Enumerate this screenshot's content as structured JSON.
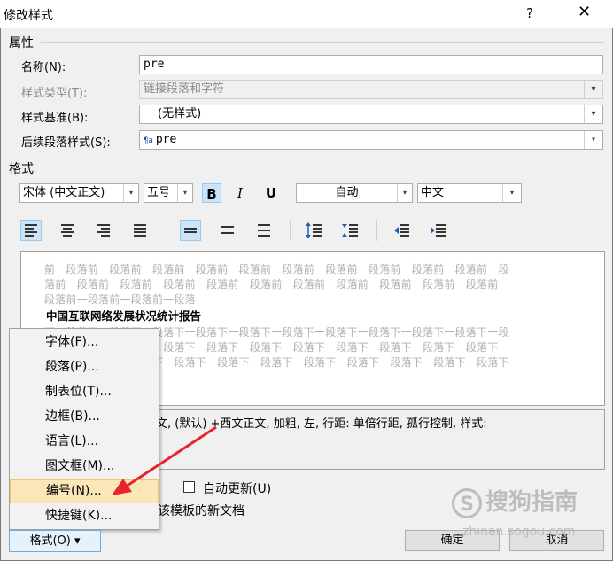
{
  "window": {
    "title": "修改样式",
    "help": "?",
    "close": "✕"
  },
  "properties": {
    "section": "属性",
    "name_label": "名称(N):",
    "name_value": "pre",
    "type_label": "样式类型(T):",
    "type_value": "链接段落和字符",
    "based_label": "样式基准(B):",
    "based_value": "(无样式)",
    "next_label": "后续段落样式(S):",
    "next_icon": "¶a",
    "next_value": "pre"
  },
  "format": {
    "section": "格式",
    "font": "宋体 (中文正文)",
    "size": "五号",
    "bold": "B",
    "italic": "I",
    "underline": "U",
    "color": "自动",
    "lang": "中文"
  },
  "preview": {
    "prev_line1": "前一段落前一段落前一段落前一段落前一段落前一段落前一段落前一段落前一段落前一段落前一段",
    "prev_line2": "落前一段落前一段落前一段落前一段落前一段落前一段落前一段落前一段落前一段落前一段落前一",
    "prev_line3": "段落前一段落前一段落前一段落",
    "sample": "中国互联网络发展状况统计报告",
    "next_line1": "下一段落下一段落下一段落下一段落下一段落下一段落下一段落下一段落下一段落下一段落下一段",
    "next_line2": "落下一段落下一段落下一段落下一段落下一段落下一段落下一段落下一段落下一段落下一段落下一",
    "next_line3": "段落下一段落下一段落下一段落下一段落下一段落下一段落下一段落下一段落下一段落下一段落下"
  },
  "description": {
    "text": "文, (默认) +西文正文, 加粗, 左, 行距: 单倍行距, 孤行控制, 样式:"
  },
  "options": {
    "auto_update": "自动更新(U)",
    "template_text": "该模板的新文档",
    "partial_radio": ")"
  },
  "menu": {
    "items": [
      {
        "label": "字体(F)..."
      },
      {
        "label": "段落(P)..."
      },
      {
        "label": "制表位(T)..."
      },
      {
        "label": "边框(B)..."
      },
      {
        "label": "语言(L)..."
      },
      {
        "label": "图文框(M)..."
      },
      {
        "label": "编号(N)..."
      },
      {
        "label": "快捷键(K)..."
      }
    ]
  },
  "buttons": {
    "format": "格式(O) ▾",
    "ok": "确定",
    "cancel": "取消"
  },
  "watermark": {
    "text": "搜狗指南",
    "url": "zhinan.sogou.com"
  },
  "colors": {
    "highlight": "#fbe6b8",
    "arrow": "#e8262a",
    "selected": "#cce4f7"
  }
}
